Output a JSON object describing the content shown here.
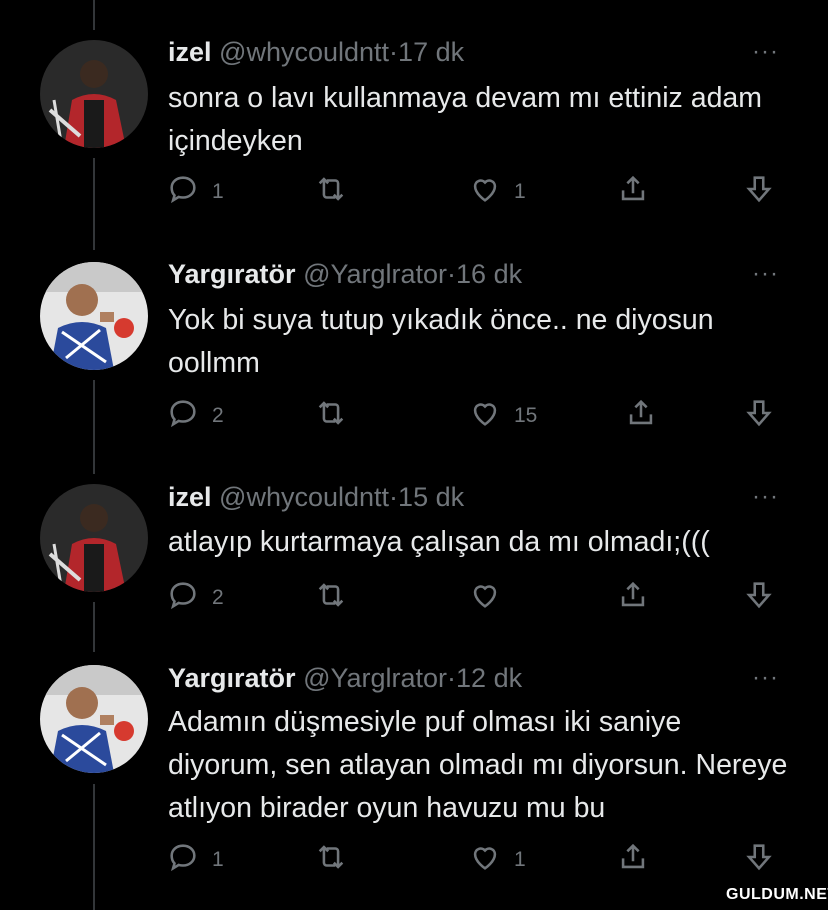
{
  "tweets": [
    {
      "name": "izel",
      "handle": "@whycouldntt",
      "time": "17 dk",
      "text": "sonra o lavı kullanmaya devam mı ettiniz adam içindeyken",
      "replies": "1",
      "retweets": "",
      "likes": "1"
    },
    {
      "name": "Yargıratör",
      "handle": "@Yarglrator",
      "time": "16 dk",
      "text": "Yok bi suya tutup yıkadık önce.. ne diyosun oollmm",
      "replies": "2",
      "retweets": "",
      "likes": "15"
    },
    {
      "name": "izel",
      "handle": "@whycouldntt",
      "time": "15 dk",
      "text": "atlayıp kurtarmaya çalışan da mı olmadı;(((",
      "replies": "2",
      "retweets": "",
      "likes": ""
    },
    {
      "name": "Yargıratör",
      "handle": "@Yarglrator",
      "time": "12 dk",
      "text": "Adamın düşmesiyle puf olması iki saniye diyorum, sen atlayan olmadı mı diyorsun. Nereye atlıyon birader oyun havuzu mu bu",
      "replies": "1",
      "retweets": "",
      "likes": "1"
    }
  ],
  "separator": "·",
  "more_label": "···",
  "watermark": "GULDUM.NET",
  "colors": {
    "background": "#000000",
    "primary_text": "#e7e9ea",
    "secondary_text": "#71767b",
    "thread_line": "#333639"
  }
}
